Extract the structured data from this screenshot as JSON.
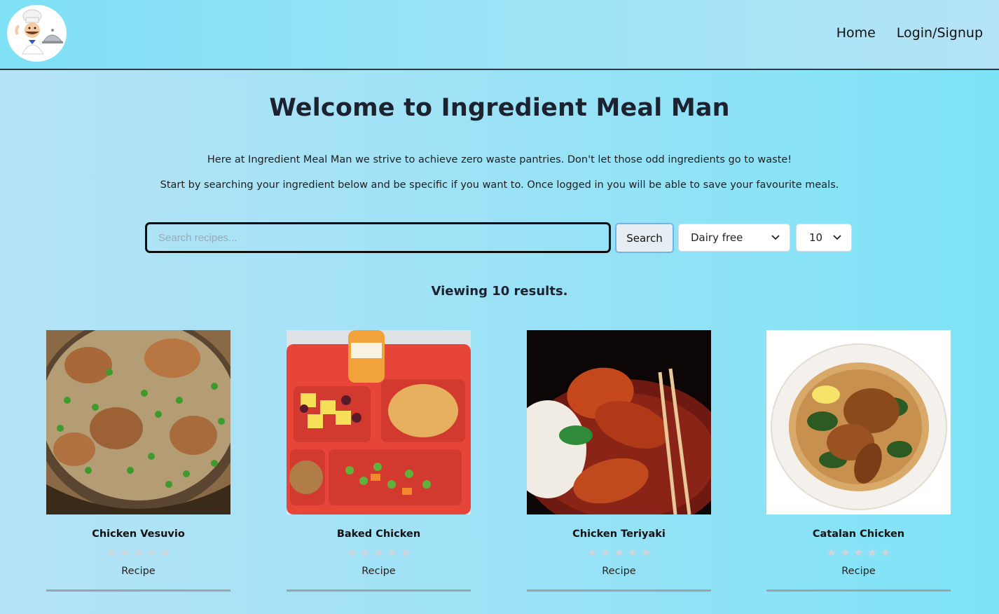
{
  "header": {
    "logo_icon": "chef-logo-icon",
    "nav": [
      {
        "label": "Home"
      },
      {
        "label": "Login/Signup"
      }
    ]
  },
  "hero": {
    "title": "Welcome to Ingredient Meal Man",
    "paragraphs": [
      "Here at Ingredient Meal Man we strive to achieve zero waste pantries. Don't let those odd ingredients go to waste!",
      "Start by searching your ingredient below and be specific if you want to. Once logged in you will be able to save your favourite meals."
    ]
  },
  "search": {
    "placeholder": "Search recipes...",
    "value": "",
    "button_label": "Search",
    "diet_filter": "Dairy free",
    "result_count": "10"
  },
  "results_text": "Viewing 10 results.",
  "recipes": [
    {
      "name": "Chicken Vesuvio",
      "link": "Recipe",
      "rating": 0
    },
    {
      "name": "Baked Chicken",
      "link": "Recipe",
      "rating": 0
    },
    {
      "name": "Chicken Teriyaki",
      "link": "Recipe",
      "rating": 0
    },
    {
      "name": "Catalan Chicken",
      "link": "Recipe",
      "rating": 0
    }
  ],
  "colors": {
    "background_start": "#b6e3f6",
    "background_end": "#7ee3f7",
    "star_empty": "#cfd6db",
    "search_button_border": "#6fb6e6"
  }
}
